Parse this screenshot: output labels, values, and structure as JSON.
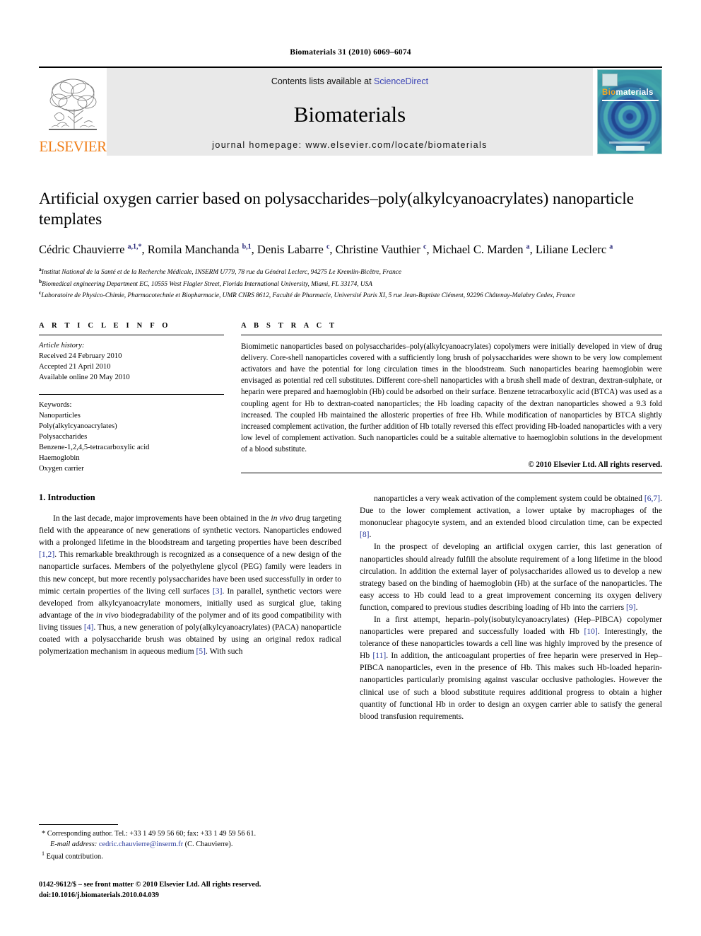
{
  "running_head": "Biomaterials 31 (2010) 6069–6074",
  "masthead": {
    "publisher_name": "ELSEVIER",
    "contents_prefix": "Contents lists available at ",
    "sciencedirect_link": "ScienceDirect",
    "journal_title": "Biomaterials",
    "homepage_line": "journal homepage: www.elsevier.com/locate/biomaterials",
    "cover": {
      "brand_part1": "Bio",
      "brand_part2": "materials"
    },
    "colors": {
      "elsevier_orange": "#F07F1A",
      "link_blue": "#3a43b5",
      "cover_teal": "#3fa3a8"
    }
  },
  "title": "Artificial oxygen carrier based on polysaccharides–poly(alkylcyanoacrylates) nanoparticle templates",
  "authors_html": "Cédric Chauvierre <sup>a,1,*</sup>, Romila Manchanda <sup>b,1</sup>, Denis Labarre <sup>c</sup>, Christine Vauthier <sup>c</sup>, Michael C. Marden <sup>a</sup>, Liliane Leclerc <sup>a</sup>",
  "affiliations": [
    {
      "mark": "a",
      "text": "Institut National de la Santé et de la Recherche Médicale, INSERM U779, 78 rue du Général Leclerc, 94275 Le Kremlin-Bicêtre, France"
    },
    {
      "mark": "b",
      "text": "Biomedical engineering Department EC, 10555 West Flagler Street, Florida International University, Miami, FL 33174, USA"
    },
    {
      "mark": "c",
      "text": "Laboratoire de Physico-Chimie, Pharmacotechnie et Biopharmacie, UMR CNRS 8612, Faculté de Pharmacie, Université Paris XI, 5 rue Jean-Baptiste Clément, 92296 Châtenay-Malabry Cedex, France"
    }
  ],
  "article_info": {
    "heading": "A R T I C L E   I N F O",
    "history_label": "Article history:",
    "history": [
      "Received 24 February 2010",
      "Accepted 21 April 2010",
      "Available online 20 May 2010"
    ],
    "keywords_label": "Keywords:",
    "keywords": [
      "Nanoparticles",
      "Poly(alkylcyanoacrylates)",
      "Polysaccharides",
      "Benzene-1,2,4,5-tetracarboxylic acid",
      "Haemoglobin",
      "Oxygen carrier"
    ]
  },
  "abstract": {
    "heading": "A B S T R A C T",
    "text": "Biomimetic nanoparticles based on polysaccharides–poly(alkylcyanoacrylates) copolymers were initially developed in view of drug delivery. Core-shell nanoparticles covered with a sufficiently long brush of polysaccharides were shown to be very low complement activators and have the potential for long circulation times in the bloodstream. Such nanoparticles bearing haemoglobin were envisaged as potential red cell substitutes. Different core-shell nanoparticles with a brush shell made of dextran, dextran-sulphate, or heparin were prepared and haemoglobin (Hb) could be adsorbed on their surface. Benzene tetracarboxylic acid (BTCA) was used as a coupling agent for Hb to dextran-coated nanoparticles; the Hb loading capacity of the dextran nanoparticles showed a 9.3 fold increased. The coupled Hb maintained the allosteric properties of free Hb. While modification of nanoparticles by BTCA slightly increased complement activation, the further addition of Hb totally reversed this effect providing Hb-loaded nanoparticles with a very low level of complement activation. Such nanoparticles could be a suitable alternative to haemoglobin solutions in the development of a blood substitute.",
    "copyright": "© 2010 Elsevier Ltd. All rights reserved."
  },
  "body": {
    "section_title": "1.  Introduction",
    "left_paragraph_html": "In the last decade, major improvements have been obtained in the <span class=\"it\">in vivo</span> drug targeting field with the appearance of new generations of synthetic vectors. Nanoparticles endowed with a prolonged lifetime in the bloodstream and targeting properties have been described <span class=\"cite\">[1,2]</span>. This remarkable breakthrough is recognized as a consequence of a new design of the nanoparticle surfaces. Members of the polyethylene glycol (PEG) family were leaders in this new concept, but more recently polysaccharides have been used successfully in order to mimic certain properties of the living cell surfaces <span class=\"cite\">[3]</span>. In parallel, synthetic vectors were developed from alkylcyanoacrylate monomers, initially used as surgical glue, taking advantage of the <span class=\"it\">in vivo</span> biodegradability of the polymer and of its good compatibility with living tissues <span class=\"cite\">[4]</span>. Thus, a new generation of poly(alkylcyanoacrylates) (PACA) nanoparticle coated with a polysaccharide brush was obtained by using an original redox radical polymerization mechanism in aqueous medium <span class=\"cite\">[5]</span>. With such",
    "right_paragraphs_html": [
      "nanoparticles a very weak activation of the complement system could be obtained <span class=\"cite\">[6,7]</span>. Due to the lower complement activation, a lower uptake by macrophages of the mononuclear phagocyte system, and an extended blood circulation time, can be expected <span class=\"cite\">[8]</span>.",
      "In the prospect of developing an artificial oxygen carrier, this last generation of nanoparticles should already fulfill the absolute requirement of a long lifetime in the blood circulation. In addition the external layer of polysaccharides allowed us to develop a new strategy based on the binding of haemoglobin (Hb) at the surface of the nanoparticles. The easy access to Hb could lead to a great improvement concerning its oxygen delivery function, compared to previous studies describing loading of Hb into the carriers <span class=\"cite\">[9]</span>.",
      "In a first attempt, heparin–poly(isobutylcyanoacrylates) (Hep–PIBCA) copolymer nanoparticles were prepared and successfully loaded with Hb <span class=\"cite\">[10]</span>. Interestingly, the tolerance of these nanoparticles towards a cell line was highly improved by the presence of Hb <span class=\"cite\">[11]</span>. In addition, the anticoagulant properties of free heparin were preserved in Hep–PIBCA nanoparticles, even in the presence of Hb. This makes such Hb-loaded heparin-nanoparticles particularly promising against vascular occlusive pathologies. However the clinical use of such a blood substitute requires additional progress to obtain a higher quantity of functional Hb in order to design an oxygen carrier able to satisfy the general blood transfusion requirements."
    ]
  },
  "footnotes": {
    "corresponding_html": "* Corresponding author. Tel.: +33 1 49 59 56 60; fax: +33 1 49 59 56 61.",
    "email_html": "<span class=\"em\">E-mail address:</span> <span class=\"mail\">cedric.chauvierre@inserm.fr</span> (C. Chauvierre).",
    "equal_contribution_html": "<span class=\"sup1\">1</span> Equal contribution."
  },
  "colophon": {
    "line1": "0142-9612/$ – see front matter © 2010 Elsevier Ltd. All rights reserved.",
    "line2": "doi:10.1016/j.biomaterials.2010.04.039"
  }
}
